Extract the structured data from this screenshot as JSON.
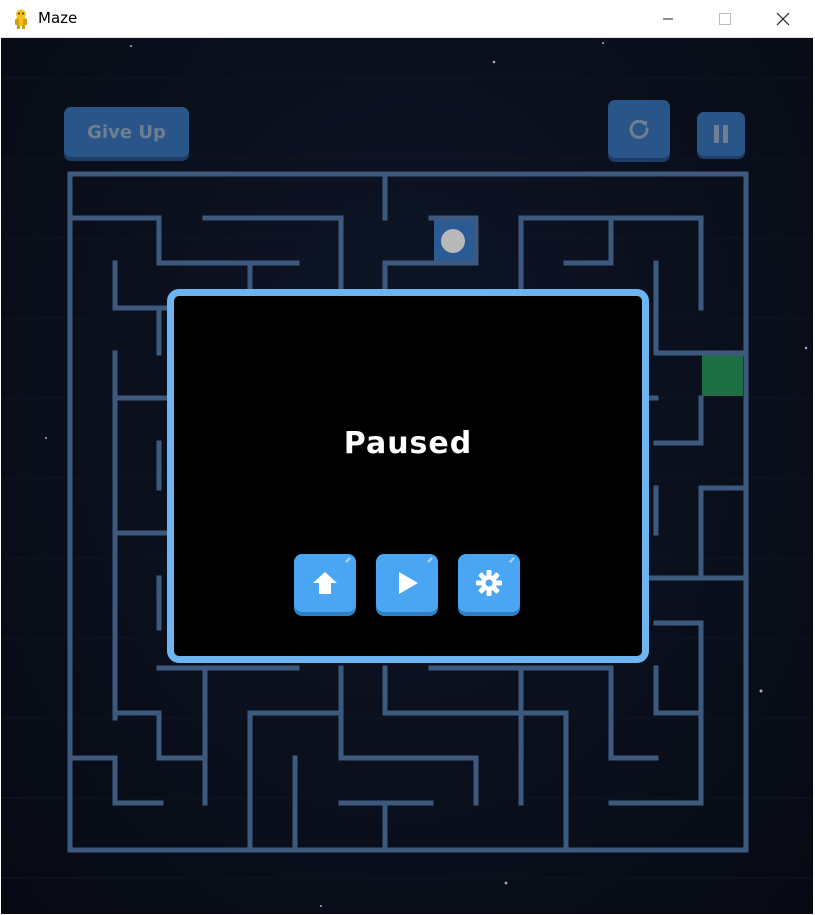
{
  "window": {
    "title": "Maze",
    "app_icon": "python-icon"
  },
  "title_controls": {
    "minimize": "minimize-icon",
    "maximize": "maximize-icon",
    "close": "close-icon"
  },
  "hud": {
    "give_up_label": "Give Up",
    "restart_icon": "restart-icon",
    "pause_icon": "pause-icon"
  },
  "pause_menu": {
    "title": "Paused",
    "buttons": [
      {
        "name": "home-button",
        "icon": "home-icon"
      },
      {
        "name": "resume-button",
        "icon": "play-icon"
      },
      {
        "name": "settings-button",
        "icon": "gear-icon"
      }
    ]
  },
  "colors": {
    "background": "#0b1120",
    "maze_wall": "#3d5a7e",
    "player_tile": "#2c5a94",
    "player": "#b9b9b9",
    "goal": "#1e6e46",
    "modal_border": "#6cb5f1",
    "menu_button": "#4aa5f2",
    "hud_button": "#2a5589"
  }
}
